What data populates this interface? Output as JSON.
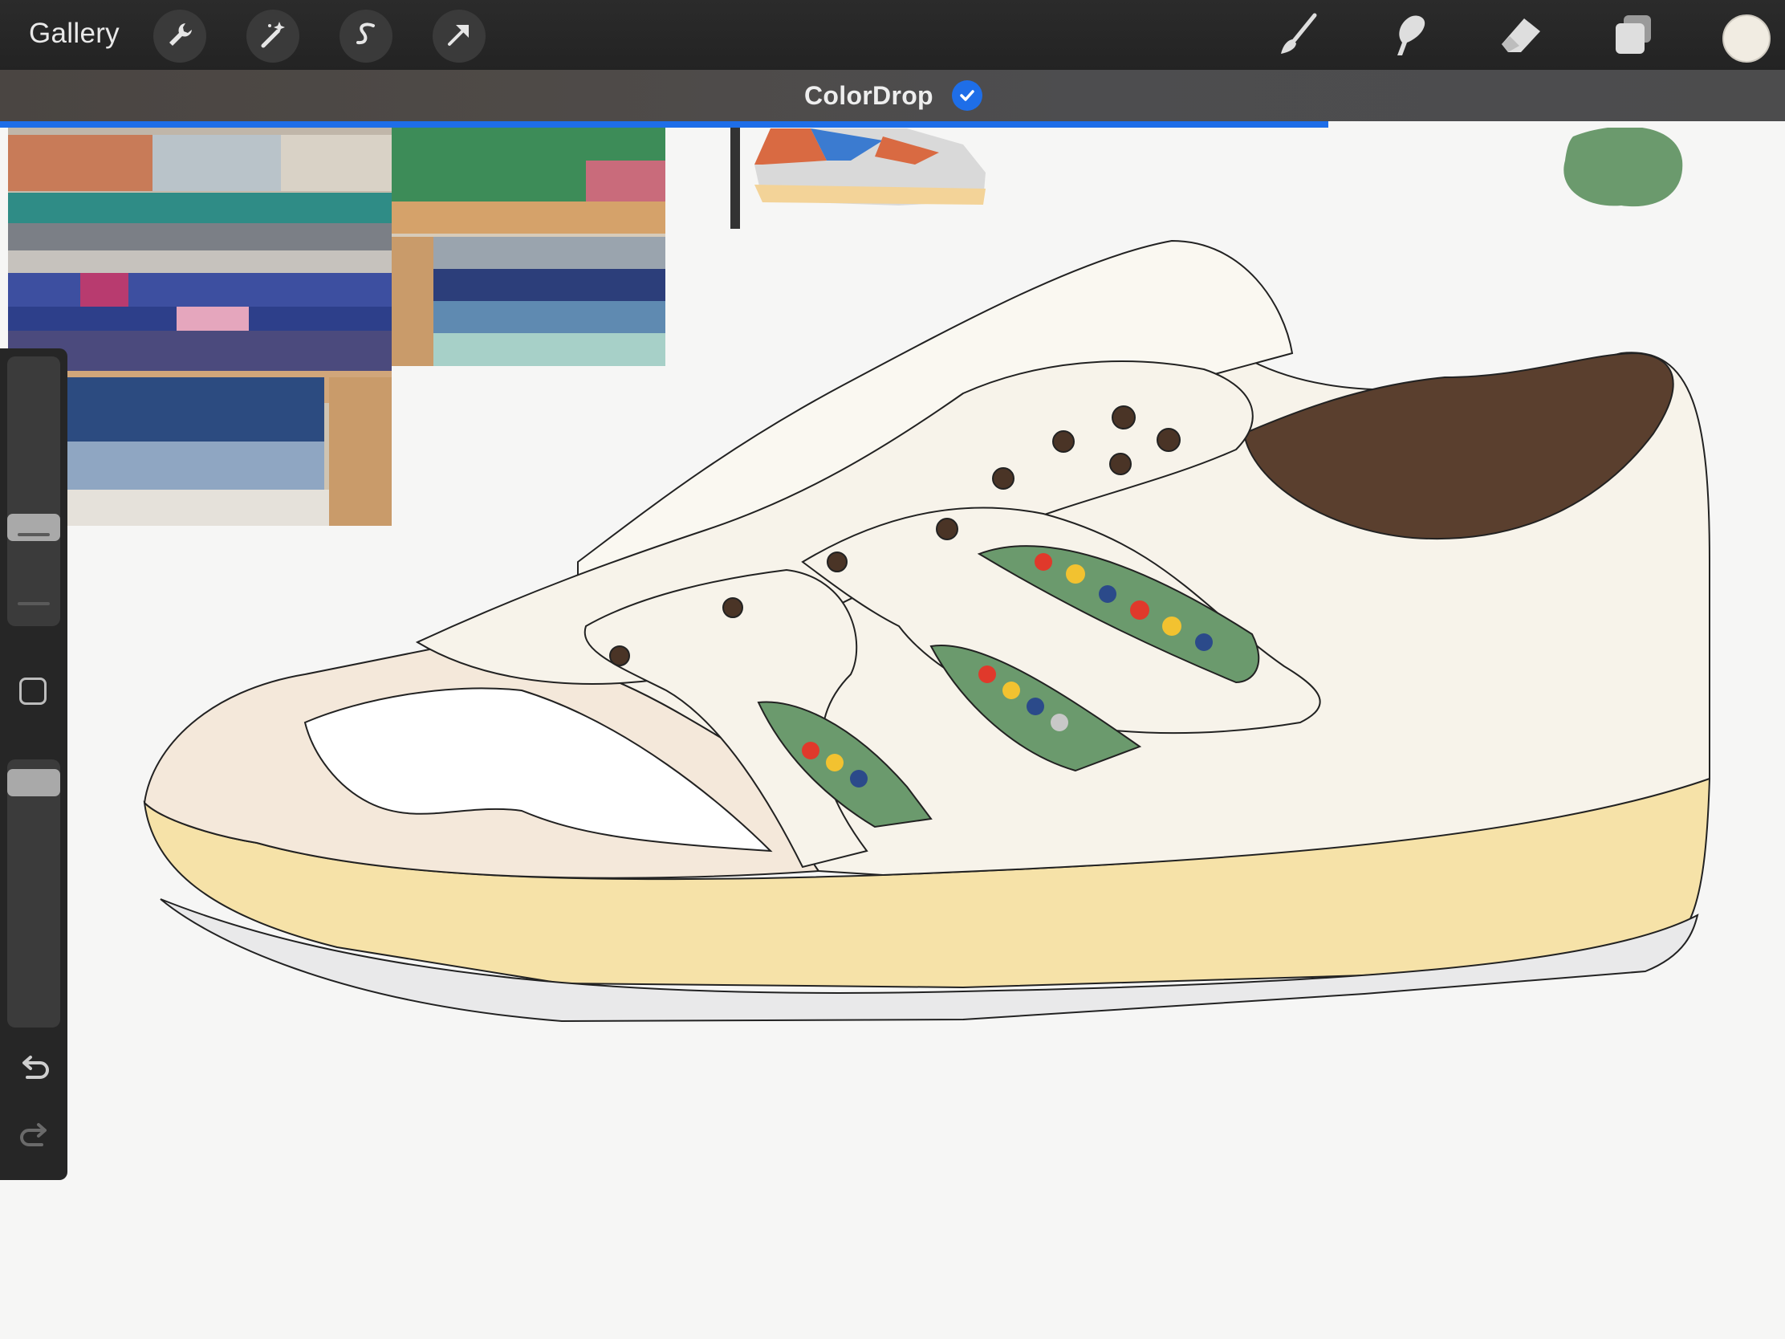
{
  "app": {
    "gallery_label": "Gallery",
    "top_tools": [
      "wrench-icon",
      "magic-wand-icon",
      "selection-s-icon",
      "transform-arrow-icon"
    ],
    "right_tools": [
      "brush-icon",
      "smudge-icon",
      "eraser-icon",
      "layers-icon"
    ],
    "current_color": "#f1ece2"
  },
  "notification": {
    "title": "ColorDrop",
    "status_color": "#1e6ee8",
    "progress": 0.744
  },
  "sidebar": {
    "brush_size_level": 0.35,
    "opacity_level": 0.04
  },
  "canvas": {
    "palette": {
      "sole": "#f6e2a8",
      "toe": "#f4e8da",
      "body": "#f7f3ea",
      "heel_collar": "#5a3f2e",
      "accent_green": "#6b9a6d"
    }
  }
}
